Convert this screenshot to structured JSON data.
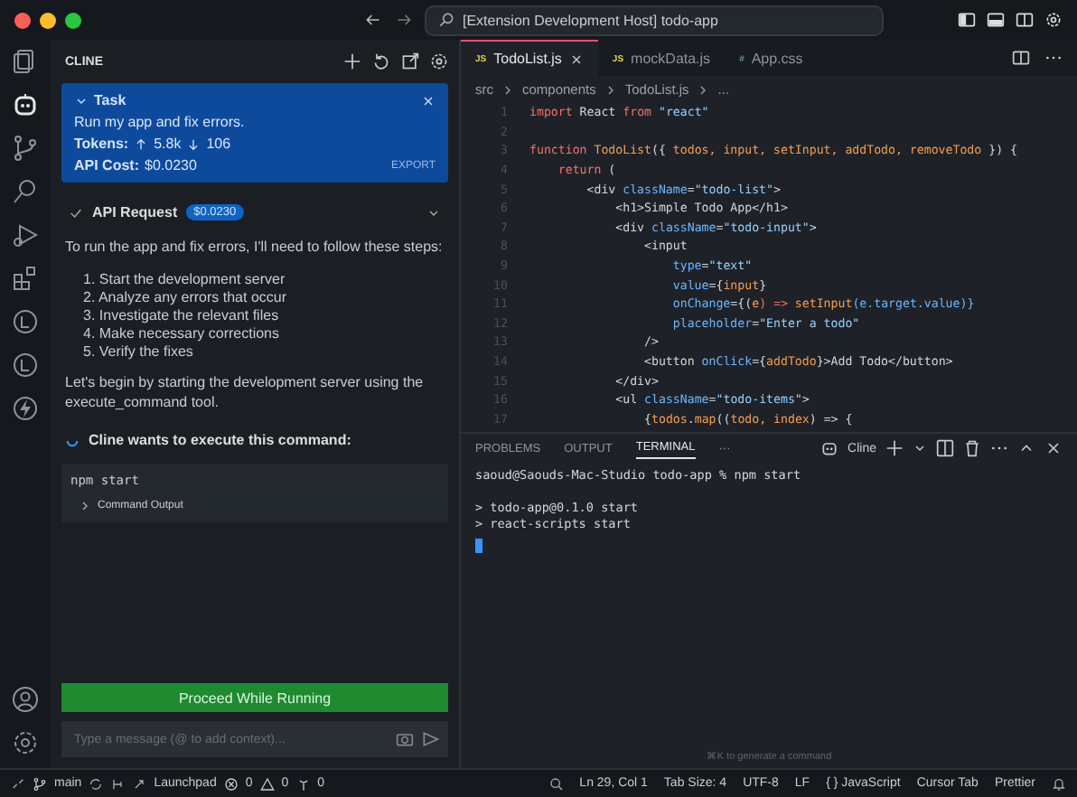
{
  "title_bar": {
    "search": "[Extension Development Host] todo-app"
  },
  "activity_bar": {
    "items": [
      {
        "selected": false
      },
      {
        "selected": true
      },
      {
        "selected": false
      },
      {
        "selected": false
      },
      {
        "selected": false
      },
      {
        "selected": false
      },
      {
        "selected": false
      },
      {
        "selected": false
      },
      {
        "selected": false
      }
    ]
  },
  "cline": {
    "title": "CLINE",
    "task": {
      "heading": "Task",
      "text": "Run my app and fix errors.",
      "tokens_label": "Tokens:",
      "tokens_up": "5.8k",
      "tokens_down": "106",
      "cost_label": "API Cost:",
      "cost": "$0.0230",
      "export": "EXPORT"
    },
    "api_request": {
      "label": "API Request",
      "cost": "$0.0230"
    },
    "intro": "To run the app and fix errors, I'll need to follow these steps:",
    "steps": [
      "1. Start the development server",
      "2. Analyze any errors that occur",
      "3. Investigate the relevant files",
      "4. Make necessary corrections",
      "5. Verify the fixes"
    ],
    "follow": "Let's begin by starting the development server using the execute_command tool.",
    "command_title": "Cline wants to execute this command:",
    "command": "npm start",
    "command_output": "Command Output",
    "proceed": "Proceed While Running",
    "input": {
      "placeholder": "Type a message (@ to add context)..."
    }
  },
  "editor": {
    "tabs": [
      {
        "label": "TodoList.js",
        "icon": "JS",
        "selected": true
      },
      {
        "label": "mockData.js",
        "icon": "JS",
        "selected": false
      },
      {
        "label": "App.css",
        "icon": "#",
        "selected": false
      }
    ],
    "breadcrumb": [
      "src",
      "components",
      "TodoList.js",
      "..."
    ],
    "lines": [
      {
        "number": "1",
        "tokens": [
          {
            "text": "import",
            "kind": "kw"
          },
          {
            "text": " React ",
            "kind": "pl"
          },
          {
            "text": "from",
            "kind": "kw"
          },
          {
            "text": " \"react\"",
            "kind": "str"
          }
        ]
      },
      {
        "number": "2"
      },
      {
        "number": "3",
        "tokens": [
          {
            "text": "function",
            "kind": "kw"
          },
          {
            "text": " TodoList",
            "kind": "fn"
          },
          {
            "text": "({ ",
            "kind": "pl"
          },
          {
            "text": "todos, input, setInput, addTodo, removeTodo",
            "kind": "var"
          },
          {
            "text": " }) {",
            "kind": "pl"
          }
        ]
      },
      {
        "number": "4",
        "tokens": [
          {
            "text": "    return",
            "kind": "kw"
          },
          {
            "text": " (",
            "kind": "pl"
          }
        ]
      },
      {
        "number": "5",
        "tokens": [
          {
            "text": "        <div ",
            "kind": "pl"
          },
          {
            "text": "className",
            "kind": "attr"
          },
          {
            "text": "=",
            "kind": "pl"
          },
          {
            "text": "\"todo-list\"",
            "kind": "str"
          },
          {
            "text": ">",
            "kind": "pl"
          }
        ]
      },
      {
        "number": "6",
        "tokens": [
          {
            "text": "            <h1>Simple Todo App</h1>",
            "kind": "pl"
          }
        ]
      },
      {
        "number": "7",
        "tokens": [
          {
            "text": "            <div ",
            "kind": "pl"
          },
          {
            "text": "className",
            "kind": "attr"
          },
          {
            "text": "=",
            "kind": "pl"
          },
          {
            "text": "\"todo-input\"",
            "kind": "str"
          },
          {
            "text": ">",
            "kind": "pl"
          }
        ]
      },
      {
        "number": "8",
        "tokens": [
          {
            "text": "                <input",
            "kind": "pl"
          }
        ]
      },
      {
        "number": "9",
        "tokens": [
          {
            "text": "                    type",
            "kind": "attr"
          },
          {
            "text": "=",
            "kind": "pl"
          },
          {
            "text": "\"text\"",
            "kind": "str"
          }
        ]
      },
      {
        "number": "10",
        "tokens": [
          {
            "text": "                    value",
            "kind": "attr"
          },
          {
            "text": "={",
            "kind": "pl"
          },
          {
            "text": "input",
            "kind": "var"
          },
          {
            "text": "}",
            "kind": "pl"
          }
        ]
      },
      {
        "number": "11",
        "tokens": [
          {
            "text": "                    onChange",
            "kind": "attr"
          },
          {
            "text": "={(",
            "kind": "pl"
          },
          {
            "text": "e",
            "kind": "var"
          },
          {
            "text": ") => ",
            "kind": "kw"
          },
          {
            "text": "setInput",
            "kind": "fn"
          },
          {
            "text": "(e.target.value)}",
            "kind": "attr"
          }
        ]
      },
      {
        "number": "12",
        "tokens": [
          {
            "text": "                    placeholder",
            "kind": "attr"
          },
          {
            "text": "=",
            "kind": "pl"
          },
          {
            "text": "\"Enter a todo\"",
            "kind": "str"
          }
        ]
      },
      {
        "number": "13",
        "tokens": [
          {
            "text": "                />",
            "kind": "pl"
          }
        ]
      },
      {
        "number": "14",
        "tokens": [
          {
            "text": "                <button ",
            "kind": "pl"
          },
          {
            "text": "onClick",
            "kind": "attr"
          },
          {
            "text": "={",
            "kind": "pl"
          },
          {
            "text": "addTodo",
            "kind": "var"
          },
          {
            "text": "}>Add Todo</button>",
            "kind": "pl"
          }
        ]
      },
      {
        "number": "15",
        "tokens": [
          {
            "text": "            </div>",
            "kind": "pl"
          }
        ]
      },
      {
        "number": "16",
        "tokens": [
          {
            "text": "            <ul ",
            "kind": "pl"
          },
          {
            "text": "className",
            "kind": "attr"
          },
          {
            "text": "=",
            "kind": "pl"
          },
          {
            "text": "\"todo-items\"",
            "kind": "str"
          },
          {
            "text": ">",
            "kind": "pl"
          }
        ]
      },
      {
        "number": "17",
        "tokens": [
          {
            "text": "                {",
            "kind": "pl"
          },
          {
            "text": "todos",
            "kind": "var"
          },
          {
            "text": ".",
            "kind": "pl"
          },
          {
            "text": "map",
            "kind": "fn"
          },
          {
            "text": "((",
            "kind": "pl"
          },
          {
            "text": "todo, index",
            "kind": "var"
          },
          {
            "text": ") => {",
            "kind": "pl"
          }
        ]
      }
    ]
  },
  "panel": {
    "tabs": [
      {
        "label": "PROBLEMS",
        "selected": false
      },
      {
        "label": "OUTPUT",
        "selected": false
      },
      {
        "label": "TERMINAL",
        "selected": true
      }
    ],
    "more": "···",
    "profile": "Cline",
    "terminal": {
      "prompt": "saoud@Saouds-Mac-Studio todo-app % npm start",
      "output": [
        "> todo-app@0.1.0 start",
        "> react-scripts start"
      ]
    },
    "hint": "⌘K to generate a command"
  },
  "status_bar": {
    "branch": "main",
    "launchpad": "Launchpad",
    "errors": "0",
    "warnings": "0",
    "ports": "0",
    "right": [
      "Ln 29, Col 1",
      "Tab Size: 4",
      "UTF-8",
      "LF",
      "{ } JavaScript",
      "Cursor Tab",
      "Prettier"
    ]
  }
}
